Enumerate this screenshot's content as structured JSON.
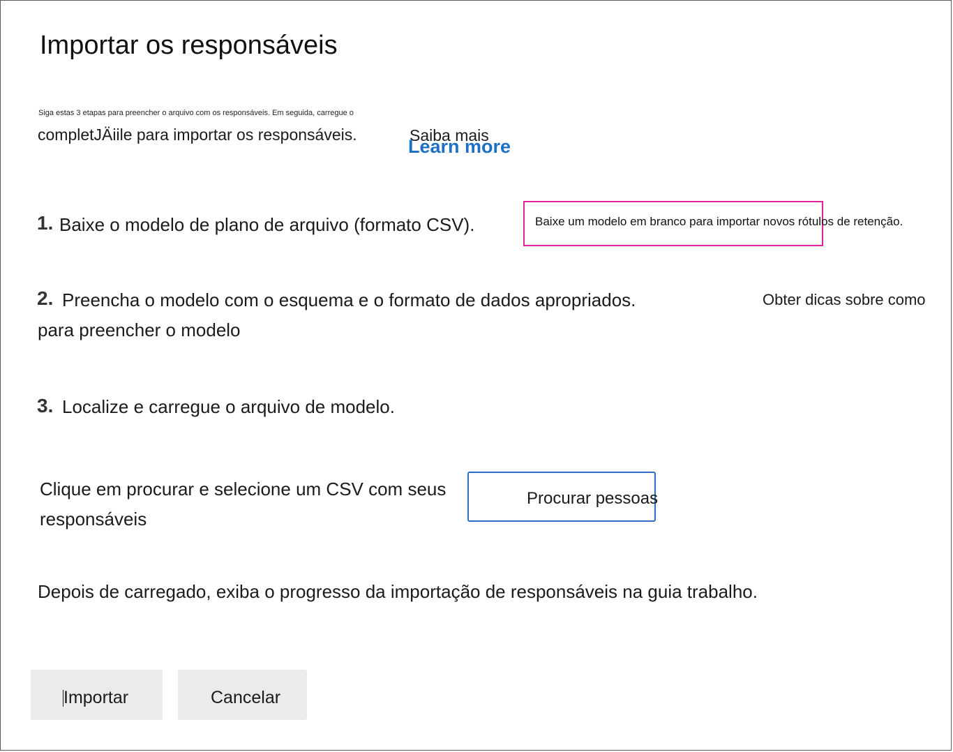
{
  "dialog": {
    "title": "Importar os responsáveis",
    "intro_small": "Siga estas 3 etapas para preencher o arquivo com os responsáveis. Em seguida, carregue o",
    "intro_large": "completJÄiile para importar os responsáveis.",
    "saiba_mais": "Saiba mais",
    "learn_more": "Learn more"
  },
  "steps": [
    {
      "number": "1.",
      "text": "Baixe o modelo de plano de arquivo (formato CSV).",
      "action": "Baixe um modelo em branco para importar novos rótulos de retenção."
    },
    {
      "number": "2.",
      "text": "Preencha o modelo com o esquema e o formato de dados apropriados.",
      "text_cont": "para preencher o modelo",
      "action": "Obter dicas sobre como"
    },
    {
      "number": "3.",
      "text": "Localize e carregue o arquivo de modelo."
    }
  ],
  "browse": {
    "label": "Clique em procurar e selecione um CSV com seus responsáveis",
    "button": "Procurar pessoas"
  },
  "after_upload": "Depois de carregado, exiba o progresso da importação de responsáveis na guia trabalho.",
  "footer": {
    "import_label": "Importar",
    "cancel_label": "Cancelar"
  },
  "colors": {
    "link": "#1f6fc4",
    "highlight_border": "#e0239b",
    "browse_border": "#2b6cc4",
    "button_bg": "#ebebeb"
  }
}
